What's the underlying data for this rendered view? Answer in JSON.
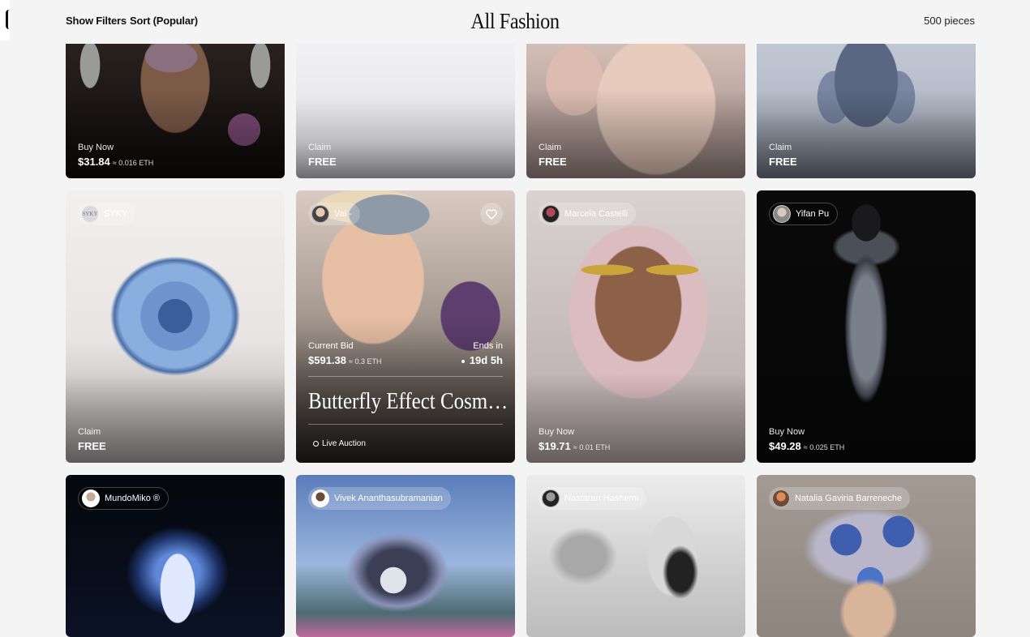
{
  "header": {
    "show_filters": "Show Filters",
    "sort": "Sort (Popular)",
    "title": "All Fashion",
    "count": "500 pieces"
  },
  "row1": [
    {
      "label": "Buy Now",
      "price": "$31.84",
      "eth": "≈ 0.016 ETH"
    },
    {
      "label": "Claim",
      "price": "FREE",
      "eth": ""
    },
    {
      "label": "Claim",
      "price": "FREE",
      "eth": ""
    },
    {
      "label": "Claim",
      "price": "FREE",
      "eth": ""
    }
  ],
  "row2": [
    {
      "creator": "SYKY",
      "avatar_text": "SYKY",
      "label": "Claim",
      "price": "FREE",
      "eth": ""
    },
    {
      "creator": "Val -",
      "current_bid_label": "Current Bid",
      "current_bid": "$591.38",
      "current_bid_eth": "≈ 0.3 ETH",
      "ends_label": "Ends in",
      "ends_value": "19d 5h",
      "title": "Butterfly Effect Cosmos S...",
      "status": "Live Auction"
    },
    {
      "creator": "Marcela Castelli",
      "label": "Buy Now",
      "price": "$19.71",
      "eth": "≈ 0.01 ETH"
    },
    {
      "creator": "Yifan Pu",
      "label": "Buy Now",
      "price": "$49.28",
      "eth": "≈ 0.025 ETH"
    }
  ],
  "row3": [
    {
      "creator": "MundoMiko ®"
    },
    {
      "creator": "Vivek Ananthasubramanian"
    },
    {
      "creator": "Nastaran Hashemi"
    },
    {
      "creator": "Natalia Gaviria Barreneche"
    }
  ],
  "icons": {
    "favorite": "heart-icon",
    "live": "circle-icon"
  }
}
